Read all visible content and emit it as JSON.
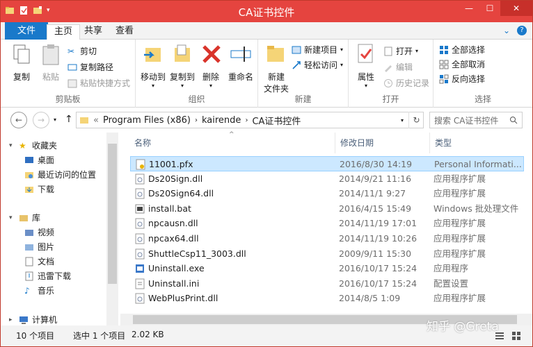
{
  "window": {
    "title": "CA证书控件"
  },
  "ribbon_tabs": [
    {
      "label": "文件"
    },
    {
      "label": "主页"
    },
    {
      "label": "共享"
    },
    {
      "label": "查看"
    }
  ],
  "ribbon": {
    "clipboard": {
      "copy": "复制",
      "paste": "粘贴",
      "cut": "剪切",
      "copy_path": "复制路径",
      "paste_shortcut": "粘贴快捷方式",
      "label": "剪贴板"
    },
    "organize": {
      "move_to": "移动到",
      "copy_to": "复制到",
      "delete": "删除",
      "rename": "重命名",
      "label": "组织"
    },
    "new": {
      "new_folder_line1": "新建",
      "new_folder_line2": "文件夹",
      "new_item": "新建项目",
      "easy_access": "轻松访问",
      "label": "新建"
    },
    "open": {
      "properties": "属性",
      "open": "打开",
      "edit": "编辑",
      "history": "历史记录",
      "label": "打开"
    },
    "select": {
      "select_all": "全部选择",
      "select_none": "全部取消",
      "invert": "反向选择",
      "label": "选择"
    }
  },
  "address": {
    "prefix": "«",
    "crumbs": [
      "Program Files (x86)",
      "kairende",
      "CA证书控件"
    ],
    "search_placeholder": "搜索 CA证书控件"
  },
  "nav": [
    {
      "label": "收藏夹",
      "icon": "star-icon"
    },
    {
      "label": "桌面",
      "icon": "desktop-icon"
    },
    {
      "label": "最近访问的位置",
      "icon": "recent-places-icon"
    },
    {
      "label": "下载",
      "icon": "download-folder-icon"
    },
    {
      "label": "库",
      "icon": "library-icon"
    },
    {
      "label": "视频",
      "icon": "video-library-icon"
    },
    {
      "label": "图片",
      "icon": "pictures-library-icon"
    },
    {
      "label": "文档",
      "icon": "documents-library-icon"
    },
    {
      "label": "迅雷下载",
      "icon": "thunder-download-icon"
    },
    {
      "label": "音乐",
      "icon": "music-library-icon"
    },
    {
      "label": "计算机",
      "icon": "computer-icon"
    }
  ],
  "columns": {
    "name": "名称",
    "date": "修改日期",
    "type": "类型"
  },
  "files": [
    {
      "name": "11001.pfx",
      "date": "2016/8/30 14:19",
      "type": "Personal Informati...",
      "icon": "certificate-file-icon"
    },
    {
      "name": "Ds20Sign.dll",
      "date": "2014/9/21 11:16",
      "type": "应用程序扩展",
      "icon": "dll-file-icon"
    },
    {
      "name": "Ds20Sign64.dll",
      "date": "2014/11/1 9:27",
      "type": "应用程序扩展",
      "icon": "dll-file-icon"
    },
    {
      "name": "install.bat",
      "date": "2016/4/15 15:49",
      "type": "Windows 批处理文件",
      "icon": "batch-file-icon"
    },
    {
      "name": "npcausn.dll",
      "date": "2014/11/19 17:01",
      "type": "应用程序扩展",
      "icon": "dll-file-icon"
    },
    {
      "name": "npcax64.dll",
      "date": "2014/11/19 10:26",
      "type": "应用程序扩展",
      "icon": "dll-file-icon"
    },
    {
      "name": "ShuttleCsp11_3003.dll",
      "date": "2009/9/11 15:30",
      "type": "应用程序扩展",
      "icon": "dll-file-icon"
    },
    {
      "name": "Uninstall.exe",
      "date": "2016/10/17 15:24",
      "type": "应用程序",
      "icon": "exe-file-icon"
    },
    {
      "name": "Uninstall.ini",
      "date": "2016/10/17 15:24",
      "type": "配置设置",
      "icon": "ini-file-icon"
    },
    {
      "name": "WebPlusPrint.dll",
      "date": "2014/8/5 1:09",
      "type": "应用程序扩展",
      "icon": "dll-file-icon"
    }
  ],
  "status": {
    "count": "10 个项目",
    "selected": "选中 1 个项目",
    "size": "2.02 KB"
  },
  "watermark": "知乎 @Greta",
  "colors": {
    "titlebar": "#e5443f",
    "file_tab": "#1979ca",
    "selection": "#cce8ff"
  }
}
